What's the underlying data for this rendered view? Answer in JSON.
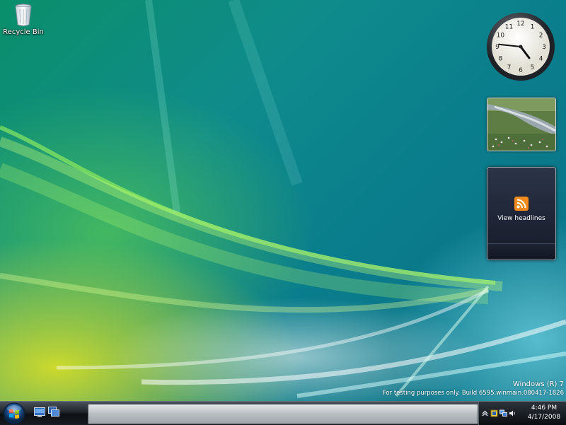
{
  "desktop": {
    "icons": [
      {
        "label": "Recycle Bin",
        "icon": "recycle-bin-icon"
      }
    ],
    "watermark": {
      "line1": "Windows (R) 7",
      "line2": "For testing purposes only. Build 6595.winmain.080417-1826"
    }
  },
  "gadgets": {
    "clock": {
      "hour": 4,
      "minute": 46,
      "numbers": [
        "12",
        "1",
        "2",
        "3",
        "4",
        "5",
        "6",
        "7",
        "8",
        "9",
        "10",
        "11"
      ]
    },
    "feed": {
      "label": "View headlines",
      "icon": "rss-icon"
    }
  },
  "taskbar": {
    "start_icon": "windows-orb-icon",
    "quick_launch": [
      "show-desktop-icon",
      "switch-windows-icon"
    ],
    "tray": {
      "icons": [
        "chevron-up-icon",
        "security-icon",
        "network-icon",
        "speaker-icon"
      ],
      "time": "4:46 PM",
      "date": "4/17/2008"
    }
  },
  "colors": {
    "desktop_teal": "#0f8b8c",
    "wave_green": "#6edc3c",
    "wave_yellow": "#d6de28",
    "rss_orange": "#f28a1c"
  }
}
